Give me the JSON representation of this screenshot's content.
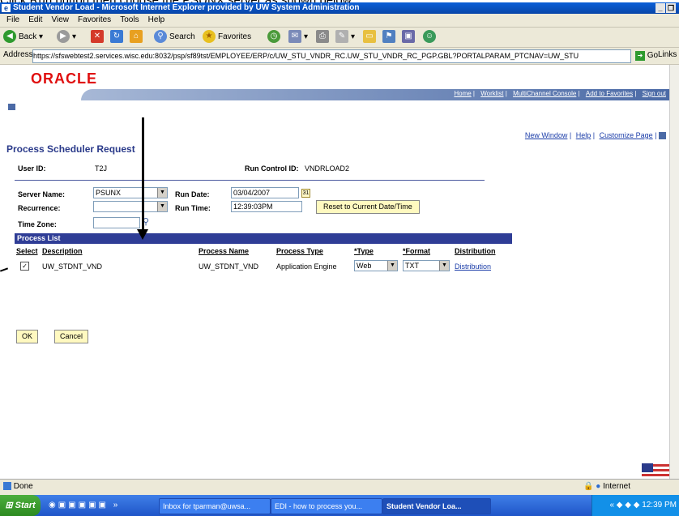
{
  "caption": "Click Run button then choose the PSUNX server as shown below:",
  "window": {
    "title": "Student Vendor Load - Microsoft Internet Explorer provided by UW System Administration"
  },
  "menu": [
    "File",
    "Edit",
    "View",
    "Favorites",
    "Tools",
    "Help"
  ],
  "toolbar": {
    "back": "Back",
    "search": "Search",
    "favorites": "Favorites"
  },
  "address": {
    "label": "Address",
    "url": "https://sfswebtest2.services.wisc.edu:8032/psp/sf89tst/EMPLOYEE/ERP/c/UW_STU_VNDR_RC.UW_STU_VNDR_RC_PGP.GBL?PORTALPARAM_PTCNAV=UW_STU",
    "go": "Go",
    "links": "Links"
  },
  "oracle": {
    "logo": "ORACLE"
  },
  "topnav": [
    "Home",
    "Worklist",
    "MultiChannel Console",
    "Add to Favorites",
    "Sign out"
  ],
  "pagelinks": [
    "New Window",
    "Help",
    "Customize Page"
  ],
  "page": {
    "title": "Process Scheduler Request",
    "user_id_label": "User ID:",
    "user_id": "T2J",
    "run_control_label": "Run Control ID:",
    "run_control": "VNDRLOAD2",
    "server_name_label": "Server Name:",
    "server_name": "PSUNX",
    "run_date_label": "Run Date:",
    "run_date": "03/04/2007",
    "recurrence_label": "Recurrence:",
    "recurrence": "",
    "run_time_label": "Run Time:",
    "run_time": "12:39:03PM",
    "reset_button": "Reset to Current Date/Time",
    "time_zone_label": "Time Zone:",
    "time_zone": ""
  },
  "process_list": {
    "header": "Process List",
    "columns": {
      "select": "Select",
      "description": "Description",
      "process_name": "Process Name",
      "process_type": "Process Type",
      "type": "*Type",
      "format": "*Format",
      "distribution": "Distribution"
    },
    "rows": [
      {
        "selected": true,
        "description": "UW_STDNT_VND",
        "process_name": "UW_STDNT_VND",
        "process_type": "Application Engine",
        "type": "Web",
        "format": "TXT",
        "distribution": "Distribution"
      }
    ]
  },
  "buttons": {
    "ok": "OK",
    "cancel": "Cancel"
  },
  "status": {
    "left": "Done",
    "zone": "Internet"
  },
  "taskbar": {
    "start": "Start",
    "tasks": [
      "Inbox for tparman@uwsa...",
      "EDI - how to process you...",
      "Student Vendor Loa..."
    ],
    "clock": "12:39 PM"
  }
}
